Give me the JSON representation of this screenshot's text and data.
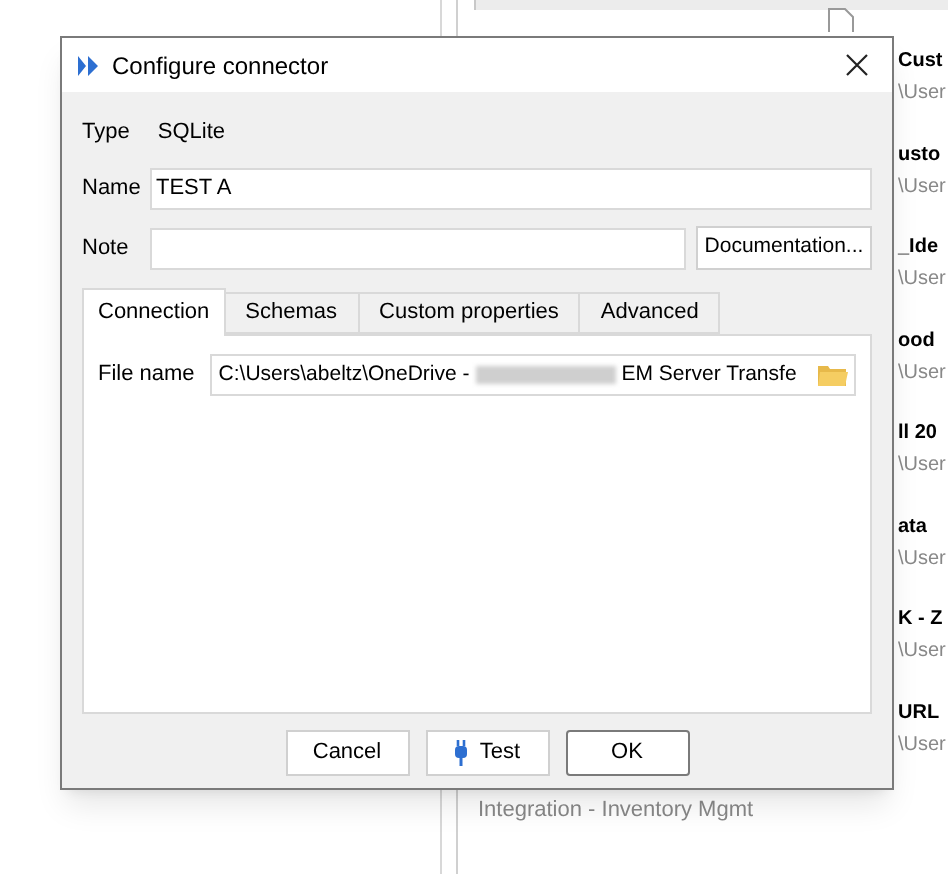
{
  "background_window": {
    "right_items": [
      {
        "title": "Cust",
        "path": "\\User"
      },
      {
        "title": "usto",
        "path": "\\User"
      },
      {
        "title": "_Ide",
        "path": "\\User"
      },
      {
        "title": "ood",
        "path": "\\User"
      },
      {
        "title": "ll 20",
        "path": "\\User"
      },
      {
        "title": "ata",
        "path": "\\User"
      },
      {
        "title": "K - Z",
        "path": "\\User"
      },
      {
        "title": "URL",
        "path": "\\User"
      }
    ],
    "bottom_text": "Integration - Inventory Mgmt"
  },
  "dialog": {
    "title": "Configure connector",
    "type_label": "Type",
    "type_value": "SQLite",
    "name_label": "Name",
    "name_value": "TEST A",
    "note_label": "Note",
    "documentation_button": "Documentation...",
    "tabs": [
      {
        "label": "Connection",
        "selected": true
      },
      {
        "label": "Schemas",
        "selected": false
      },
      {
        "label": "Custom properties",
        "selected": false
      },
      {
        "label": "Advanced",
        "selected": false
      }
    ],
    "file_name_label": "File name",
    "file_name_start": "C:\\Users\\abeltz\\OneDrive -",
    "file_name_end": "EM Server Transfe",
    "buttons": [
      {
        "label": "Cancel",
        "kind": "plain"
      },
      {
        "label": "Test",
        "kind": "plug"
      },
      {
        "label": "OK",
        "kind": "default"
      }
    ]
  }
}
